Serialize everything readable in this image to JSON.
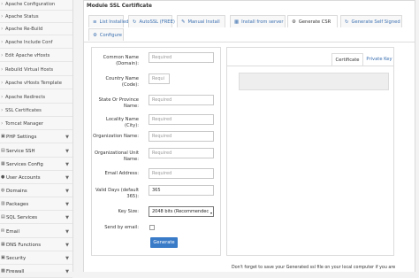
{
  "sidebar": {
    "items": [
      {
        "label": "Apache Configuration"
      },
      {
        "label": "Apache Status"
      },
      {
        "label": "Apache Re-Build"
      },
      {
        "label": "Apache Include Conf"
      },
      {
        "label": "Edit Apache vHosts"
      },
      {
        "label": "Rebuild Virtual Hosts"
      },
      {
        "label": "Apache vHosts Template"
      },
      {
        "label": "Apache Redirects"
      },
      {
        "label": "SSL Certificates"
      },
      {
        "label": "Tomcat Manager"
      }
    ],
    "categories": [
      {
        "label": "PHP Settings",
        "icon": "php-icon"
      },
      {
        "label": "Service SSH",
        "icon": "terminal-icon"
      },
      {
        "label": "Services Config",
        "icon": "server-icon"
      },
      {
        "label": "User Accounts",
        "icon": "user-icon"
      },
      {
        "label": "Domains",
        "icon": "globe-icon"
      },
      {
        "label": "Packages",
        "icon": "package-icon"
      },
      {
        "label": "SQL Services",
        "icon": "database-icon"
      },
      {
        "label": "Email",
        "icon": "mail-icon"
      },
      {
        "label": "DNS Functions",
        "icon": "dns-icon"
      },
      {
        "label": "Security",
        "icon": "lock-icon"
      },
      {
        "label": "Firewall",
        "icon": "firewall-icon"
      }
    ]
  },
  "panel": {
    "title": "Module SSL Certificate",
    "tabs": [
      {
        "label": "List Installed",
        "icon": "list-icon"
      },
      {
        "label": "AutoSSL (FREE)",
        "icon": "refresh-icon"
      },
      {
        "label": "Manual Install",
        "icon": "edit-icon"
      },
      {
        "label": "Install from server",
        "icon": "server-icon"
      },
      {
        "label": "Generate CSR",
        "icon": "gear-icon"
      },
      {
        "label": "Generate Self Signed",
        "icon": "refresh-icon"
      },
      {
        "label": "Configure",
        "icon": "gear-icon"
      }
    ]
  },
  "form": {
    "fields": [
      {
        "label": "Common Name (Domain):",
        "placeholder": "Required"
      },
      {
        "label": "Country Name (Code):",
        "placeholder": "Requi"
      },
      {
        "label": "State Or Province Name:",
        "placeholder": "Required"
      },
      {
        "label": "Locality Name (City):",
        "placeholder": "Required"
      },
      {
        "label": "Organization Name:",
        "placeholder": "Required"
      },
      {
        "label": "Organizational Unit Name:",
        "placeholder": "Required"
      },
      {
        "label": "Email Address:",
        "placeholder": "Required"
      },
      {
        "label": "Valid Days (default 365):",
        "value": "365"
      }
    ],
    "key_size": {
      "label": "Key Size:",
      "selected": "2048 bits (Recommendec"
    },
    "send_email": {
      "label": "Send by email:",
      "checked": false
    },
    "generate_label": "Generate"
  },
  "right": {
    "tab_certificate": "Certificate",
    "tab_private_key": "Private Key",
    "footer_note": "Don't forget to save your Generated ssl file on your local computer if you are"
  }
}
